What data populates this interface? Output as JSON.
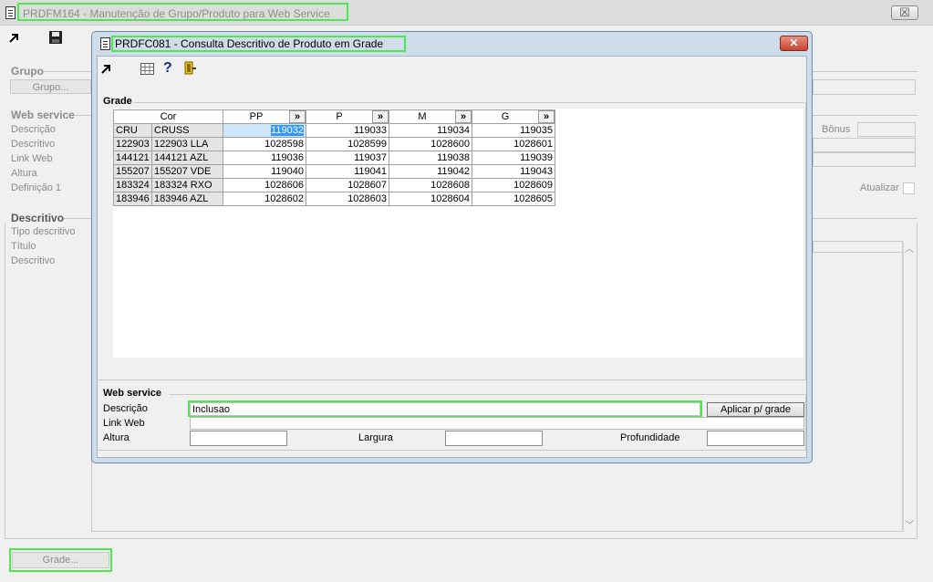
{
  "parent": {
    "title": "PRDFM164 - Manutenção de Grupo/Produto para Web Service",
    "close_glyph": "☒",
    "grupo": {
      "legend": "Grupo",
      "button": "Grupo..."
    },
    "web_service": {
      "legend": "Web service",
      "labels": [
        "Descrição",
        "Descritivo",
        "Link Web",
        "Altura",
        "Definição 1"
      ],
      "bonus_label": "Bônus",
      "atualizar_label": "Atualizar"
    },
    "descritivo": {
      "legend": "Descritivo",
      "labels": [
        "Tipo descritivo",
        "Título",
        "Descritivo"
      ]
    },
    "grade_button": "Grade..."
  },
  "dialog": {
    "title": "PRDFC081 - Consulta Descritivo de Produto em Grade",
    "close_glyph": "✕",
    "toolbar": {
      "help_glyph": "?"
    },
    "grade": {
      "legend": "Grade",
      "header_cor": "Cor",
      "chev": "»",
      "sizes": [
        "PP",
        "P",
        "M",
        "G"
      ],
      "rows": [
        {
          "code": "CRU",
          "cor": "CRUSS",
          "values": [
            "119032",
            "119033",
            "119034",
            "119035"
          ]
        },
        {
          "code": "122903",
          "cor": "122903 LLA",
          "values": [
            "1028598",
            "1028599",
            "1028600",
            "1028601"
          ]
        },
        {
          "code": "144121",
          "cor": "144121 AZL",
          "values": [
            "119036",
            "119037",
            "119038",
            "119039"
          ]
        },
        {
          "code": "155207",
          "cor": "155207 VDE",
          "values": [
            "119040",
            "119041",
            "119042",
            "119043"
          ]
        },
        {
          "code": "183324",
          "cor": "183324 RXO",
          "values": [
            "1028606",
            "1028607",
            "1028608",
            "1028609"
          ]
        },
        {
          "code": "183946",
          "cor": "183946 AZL",
          "values": [
            "1028602",
            "1028603",
            "1028604",
            "1028605"
          ]
        }
      ]
    },
    "web_service": {
      "legend": "Web service",
      "descricao_label": "Descrição",
      "descricao_value": "Inclusao",
      "apply_button": "Aplicar p/ grade",
      "link_label": "Link Web",
      "altura_label": "Altura",
      "largura_label": "Largura",
      "profundidade_label": "Profundidade"
    }
  }
}
